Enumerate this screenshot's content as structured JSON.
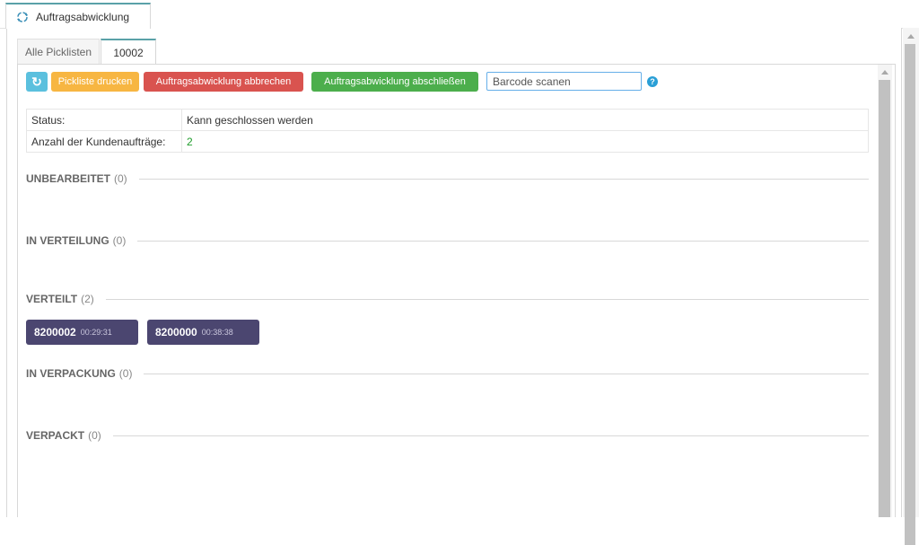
{
  "window_tab": {
    "label": "Auftragsabwicklung",
    "icon": "refresh-cycle-icon"
  },
  "tabs": [
    {
      "label": "Alle Picklisten",
      "active": false
    },
    {
      "label": "10002",
      "active": true
    }
  ],
  "toolbar": {
    "refresh_icon": "↻",
    "print_label": "Pickliste drucken",
    "abort_label": "Auftragsabwicklung abbrechen",
    "finish_label": "Auftragsabwicklung abschließen",
    "barcode_placeholder": "Barcode scanen",
    "help_icon": "?"
  },
  "info": {
    "status_label": "Status:",
    "status_value": "Kann geschlossen werden",
    "orders_label": "Anzahl der Kundenaufträge:",
    "orders_value": "2"
  },
  "sections": [
    {
      "title": "UNBEARBEITET",
      "count": "(0)"
    },
    {
      "title": "IN VERTEILUNG",
      "count": "(0)"
    },
    {
      "title": "VERTEILT",
      "count": "(2)"
    },
    {
      "title": "IN VERPACKUNG",
      "count": "(0)"
    },
    {
      "title": "VERPACKT",
      "count": "(0)"
    }
  ],
  "distributed_orders": [
    {
      "number": "8200002",
      "time": "00:29:31"
    },
    {
      "number": "8200000",
      "time": "00:38:38"
    }
  ],
  "colors": {
    "accent_teal": "#5aa1a8",
    "refresh": "#5bc0de",
    "print": "#f7b642",
    "abort": "#d9534f",
    "finish": "#4cae4c",
    "chip": "#4b4670",
    "green_value": "#1e9c2a"
  }
}
